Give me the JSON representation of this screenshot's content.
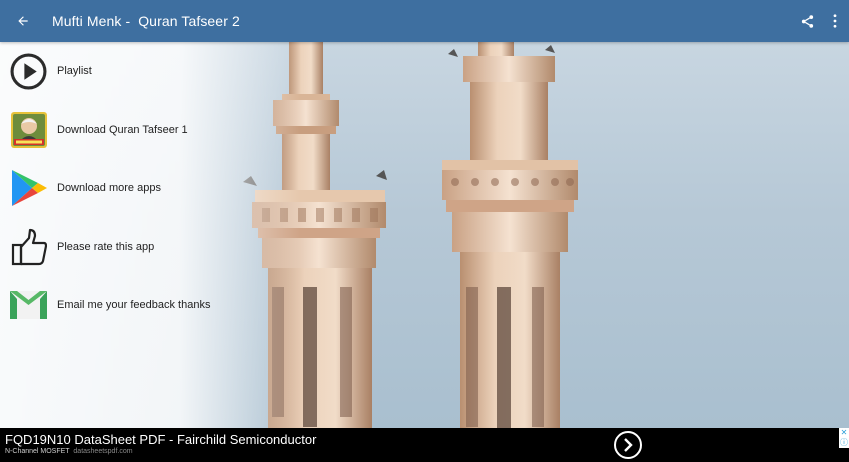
{
  "appbar": {
    "title": "Mufti Menk -  Quran Tafseer 2",
    "back_icon": "arrow-left-icon",
    "share_icon": "share-icon",
    "more_icon": "more-vertical-icon",
    "background_color": "#3e6fa0"
  },
  "menu": {
    "items": [
      {
        "label": "Playlist",
        "icon": "play-circle-icon"
      },
      {
        "label": "Download Quran Tafseer 1",
        "icon": "app-thumbnail-icon"
      },
      {
        "label": "Download more apps",
        "icon": "play-store-icon"
      },
      {
        "label": "Please rate this app",
        "icon": "thumbs-up-icon"
      },
      {
        "label": "Email me your feedback thanks",
        "icon": "gmail-icon"
      }
    ]
  },
  "ad": {
    "title": "FQD19N10 DataSheet PDF - Fairchild Semiconductor",
    "subtitle": "N-Channel MOSFET",
    "url": "datasheetspdf.com",
    "arrow_icon": "chevron-right-circle-icon",
    "adchoices_icon": "adchoices-icon"
  }
}
